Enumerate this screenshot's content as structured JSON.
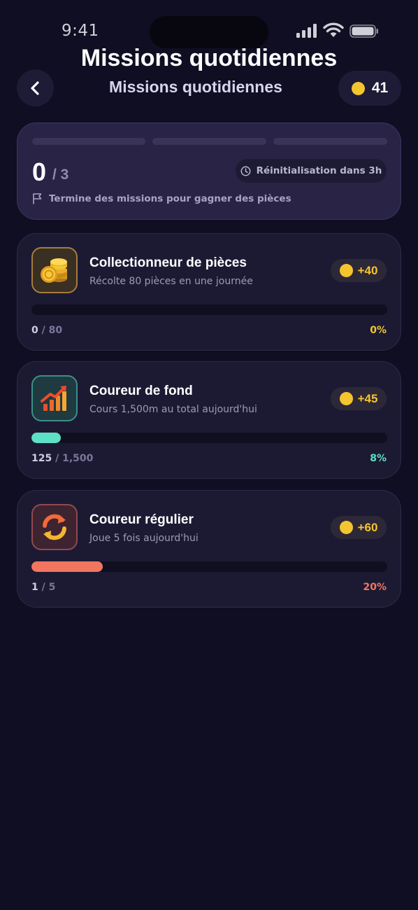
{
  "status_bar": {
    "time": "9:41"
  },
  "overlay_title": "Missions quotidiennes",
  "header": {
    "title": "Missions quotidiennes",
    "coins": "41"
  },
  "summary": {
    "completed": "0",
    "total": "/ 3",
    "reset_text": "Réinitialisation dans 3h",
    "hint": "Termine des missions pour gagner des pièces"
  },
  "missions": [
    {
      "title": "Collectionneur de pièces",
      "description": "Récolte 80 pièces en une journée",
      "reward": "+40",
      "current": "0",
      "target": "/ 80",
      "percent": "0%",
      "progress": 0,
      "icon": "coins-stack-icon",
      "accent": "#f5c530"
    },
    {
      "title": "Coureur de fond",
      "description": "Cours 1,500m au total aujourd'hui",
      "reward": "+45",
      "current": "125",
      "target": "/ 1,500",
      "percent": "8%",
      "progress": 0.083,
      "icon": "growth-chart-icon",
      "accent": "#5de0c6"
    },
    {
      "title": "Coureur régulier",
      "description": "Joue 5 fois aujourd'hui",
      "reward": "+60",
      "current": "1",
      "target": "/ 5",
      "percent": "20%",
      "progress": 0.2,
      "icon": "refresh-arrows-icon",
      "accent": "#f2765f"
    }
  ]
}
